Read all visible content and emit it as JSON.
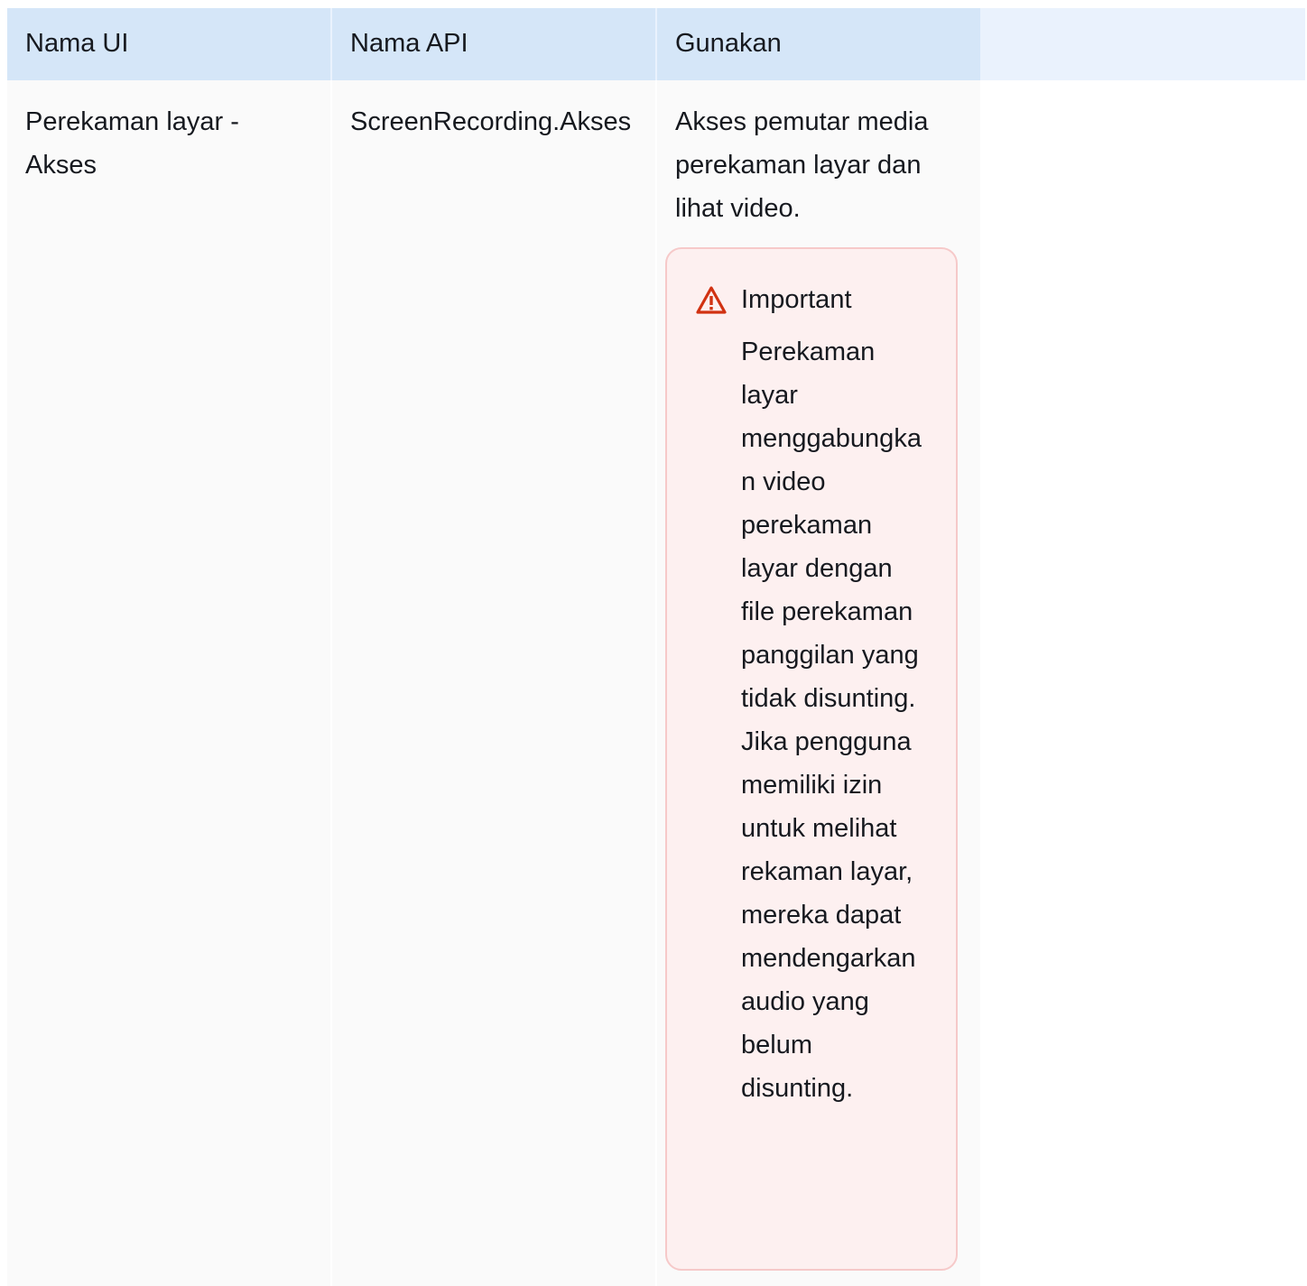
{
  "table": {
    "headers": [
      "Nama UI",
      "Nama API",
      "Gunakan"
    ],
    "rows": [
      {
        "ui_name": "Perekaman layar - Akses",
        "api_name": "ScreenRecording.Akses",
        "use": "Akses pemutar media perekaman layar dan lihat video."
      }
    ]
  },
  "callout": {
    "icon": "warning-triangle-icon",
    "color": "#d13212",
    "title": "Important",
    "text": "Perekaman layar menggabungkan video perekaman layar dengan file perekaman panggilan yang tidak disunting. Jika pengguna memiliki izin untuk melihat rekaman layar, mereka dapat mendengarkan audio yang belum disunting."
  }
}
